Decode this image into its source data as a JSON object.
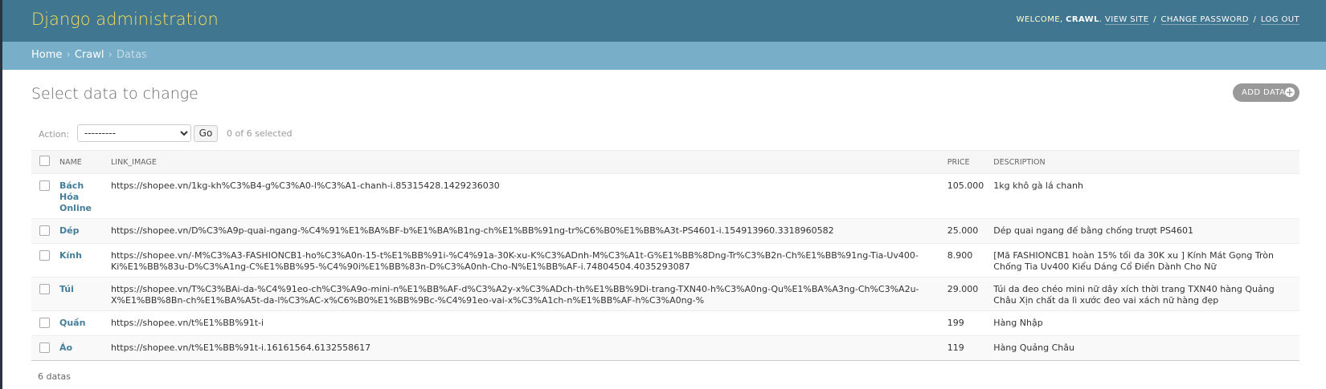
{
  "header": {
    "title": "Django administration",
    "welcome": "Welcome,",
    "username": "CRAWL",
    "links": {
      "view_site": "View site",
      "change_password": "Change password",
      "log_out": "Log out"
    }
  },
  "breadcrumbs": {
    "home": "Home",
    "app": "Crawl",
    "current": "Datas"
  },
  "page": {
    "title": "Select data to change",
    "add_button": "ADD DATA"
  },
  "actions": {
    "label": "Action:",
    "selected_option": "---------",
    "go_label": "Go",
    "selection_count": "0 of 6 selected"
  },
  "table": {
    "columns": [
      "NAME",
      "LINK_IMAGE",
      "PRICE",
      "DESCRIPTION"
    ],
    "rows": [
      {
        "name": "Bách Hóa Online",
        "link_image": "https://shopee.vn/1kg-kh%C3%B4-g%C3%A0-l%C3%A1-chanh-i.85315428.1429236030",
        "price": "105.000",
        "description": "1kg khô gà lá chanh"
      },
      {
        "name": "Dép",
        "link_image": "https://shopee.vn/D%C3%A9p-quai-ngang-%C4%91%E1%BA%BF-b%E1%BA%B1ng-ch%E1%BB%91ng-tr%C6%B0%E1%BB%A3t-PS4601-i.154913960.3318960582",
        "price": "25.000",
        "description": "Dép quai ngang đế bằng chống trượt PS4601"
      },
      {
        "name": "Kính",
        "link_image": "https://shopee.vn/-M%C3%A3-FASHIONCB1-ho%C3%A0n-15-t%E1%BB%91i-%C4%91a-30K-xu-K%C3%ADnh-M%C3%A1t-G%E1%BB%8Dng-Tr%C3%B2n-Ch%E1%BB%91ng-Tia-Uv400-Ki%E1%BB%83u-D%C3%A1ng-C%E1%BB%95-%C4%90i%E1%BB%83n-D%C3%A0nh-Cho-N%E1%BB%AF-i.74804504.4035293087",
        "price": "8.900",
        "description": "[Mã FASHIONCB1 hoàn 15% tối đa 30K xu ] Kính Mát Gọng Tròn Chống Tia Uv400 Kiểu Dáng Cổ Điển Dành Cho Nữ"
      },
      {
        "name": "Túi",
        "link_image": "https://shopee.vn/T%C3%BAi-da-%C4%91eo-ch%C3%A9o-mini-n%E1%BB%AF-d%C3%A2y-x%C3%ADch-th%E1%BB%9Di-trang-TXN40-h%C3%A0ng-Qu%E1%BA%A3ng-Ch%C3%A2u-X%E1%BB%8Bn-ch%E1%BA%A5t-da-l%C3%AC-x%C6%B0%E1%BB%9Bc-%C4%91eo-vai-x%C3%A1ch-n%E1%BB%AF-h%C3%A0ng-%",
        "price": "29.000",
        "description": "Túi da đeo chéo mini nữ dây xích thời trang TXN40 hàng Quảng Châu Xịn chất da lì xước đeo vai xách nữ hàng đẹp"
      },
      {
        "name": "Quần",
        "link_image": "https://shopee.vn/t%E1%BB%91t-i",
        "price": "199",
        "description": "Hàng Nhập"
      },
      {
        "name": "Áo",
        "link_image": "https://shopee.vn/t%E1%BB%91t-i.16161564.6132558617",
        "price": "119",
        "description": "Hàng Quảng Châu"
      }
    ]
  },
  "footer": {
    "count": "6 datas"
  }
}
